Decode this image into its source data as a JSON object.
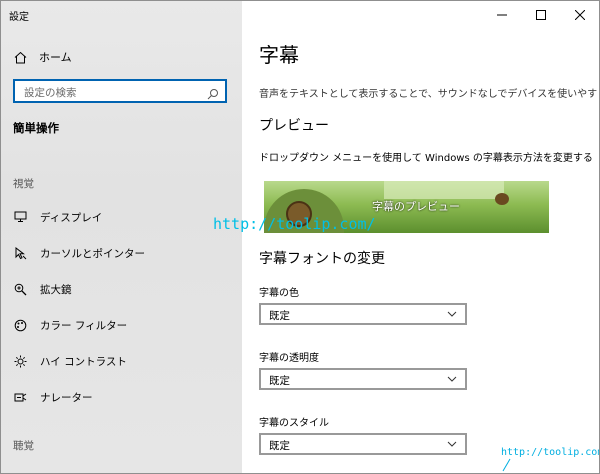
{
  "window": {
    "title": "設定"
  },
  "sidebar": {
    "home_label": "ホーム",
    "search_placeholder": "設定の検索",
    "category": "簡単操作",
    "section_vision": "視覚",
    "items": [
      {
        "label": "ディスプレイ",
        "icon": "display-icon"
      },
      {
        "label": "カーソルとポインター",
        "icon": "pointer-icon"
      },
      {
        "label": "拡大鏡",
        "icon": "magnifier-icon"
      },
      {
        "label": "カラー フィルター",
        "icon": "color-filter-icon"
      },
      {
        "label": "ハイ コントラスト",
        "icon": "high-contrast-icon"
      },
      {
        "label": "ナレーター",
        "icon": "narrator-icon"
      }
    ],
    "section_hearing": "聴覚"
  },
  "main": {
    "title": "字幕",
    "description": "音声をテキストとして表示することで、サウンドなしでデバイスを使いやすくします。",
    "preview_heading": "プレビュー",
    "preview_description": "ドロップダウン メニューを使用して Windows の字幕表示方法を変更する",
    "preview_caption": "字幕のプレビュー",
    "font_heading": "字幕フォントの変更",
    "settings": [
      {
        "label": "字幕の色",
        "value": "既定"
      },
      {
        "label": "字幕の透明度",
        "value": "既定"
      },
      {
        "label": "字幕のスタイル",
        "value": "既定"
      }
    ]
  },
  "watermarks": {
    "center": "http://toolip.com/",
    "corner": "http://toolip.com"
  },
  "colors": {
    "accent": "#0063b1",
    "sidebar_bg": "#e6e6e6"
  }
}
